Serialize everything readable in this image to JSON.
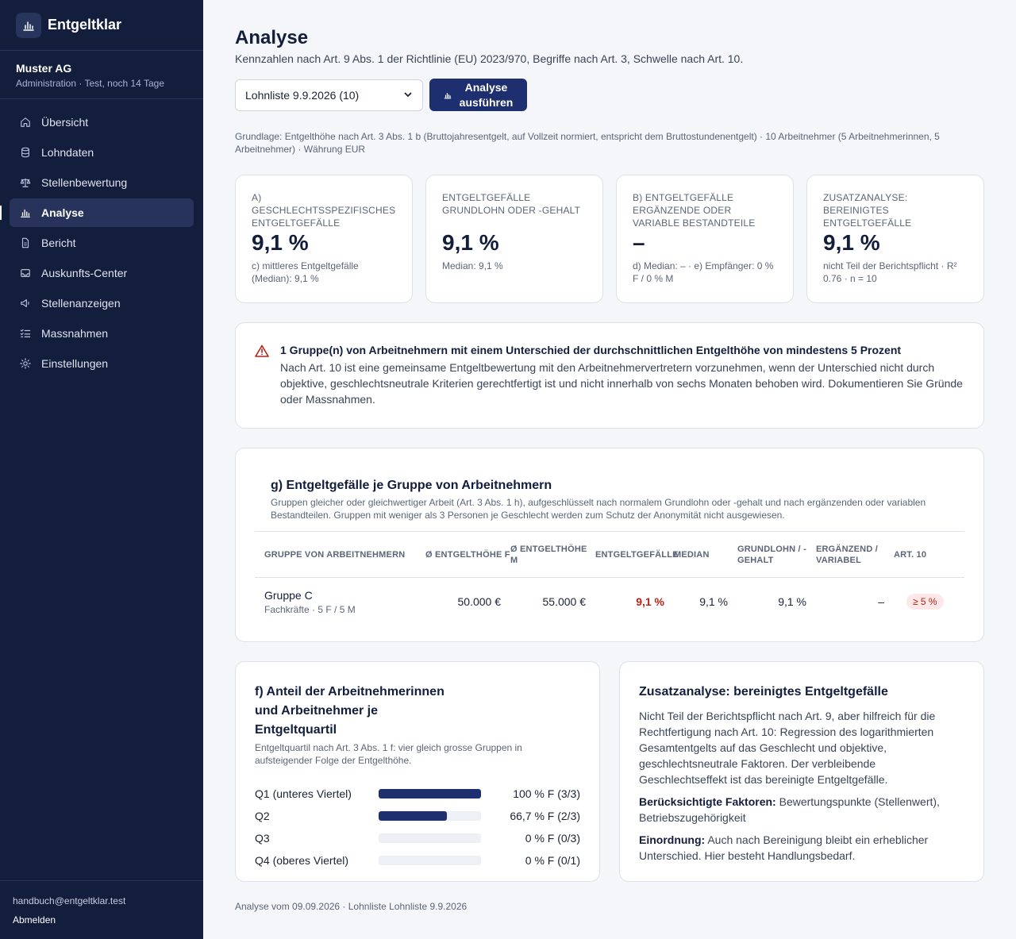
{
  "app": {
    "name": "Entgeltklar"
  },
  "org": {
    "name": "Muster AG",
    "meta": "Administration · Test, noch 14 Tage"
  },
  "nav": [
    {
      "label": "Übersicht",
      "icon": "home-icon"
    },
    {
      "label": "Lohndaten",
      "icon": "database-icon"
    },
    {
      "label": "Stellenbewertung",
      "icon": "scale-icon"
    },
    {
      "label": "Analyse",
      "icon": "bar-chart-icon",
      "active": true
    },
    {
      "label": "Bericht",
      "icon": "document-icon"
    },
    {
      "label": "Auskunfts-Center",
      "icon": "inbox-icon"
    },
    {
      "label": "Stellenanzeigen",
      "icon": "megaphone-icon"
    },
    {
      "label": "Massnahmen",
      "icon": "checklist-icon"
    },
    {
      "label": "Einstellungen",
      "icon": "settings-icon"
    }
  ],
  "user": {
    "email": "handbuch@entgeltklar.test",
    "logout": "Abmelden"
  },
  "page": {
    "title": "Analyse",
    "subtitle": "Kennzahlen nach Art. 9 Abs. 1 der Richtlinie (EU) 2023/970, Begriffe nach Art. 3, Schwelle nach Art. 10."
  },
  "controls": {
    "select_value": "Lohnliste 9.9.2026 (10)",
    "run_button_line1": "Analyse",
    "run_button_line2": "ausführen"
  },
  "basis": "Grundlage: Entgelthöhe nach Art. 3 Abs. 1 b (Bruttojahresentgelt, auf Vollzeit normiert, entspricht dem Bruttostundenentgelt) · 10 Arbeitnehmer (5 Arbeitnehmerinnen, 5 Arbeitnehmer) · Währung EUR",
  "kpis": [
    {
      "label": "a) geschlechtsspezifisches Entgeltgefälle",
      "value": "9,1 %",
      "note": "c) mittleres Entgeltgefälle (Median): 9,1 %"
    },
    {
      "label": "Entgeltgefälle Grundlohn oder -gehalt",
      "value": "9,1 %",
      "note": "Median: 9,1 %"
    },
    {
      "label": "b) Entgeltgefälle ergänzende oder variable Bestandteile",
      "value": "–",
      "note": "d) Median: – · e) Empfänger: 0 % F / 0 % M"
    },
    {
      "label": "Zusatzanalyse: bereinigtes Entgeltgefälle",
      "value": "9,1 %",
      "note": "nicht Teil der Berichtspflicht · R² 0.76 · n = 10"
    }
  ],
  "alert": {
    "title": "1 Gruppe(n) von Arbeitnehmern mit einem Unterschied der durchschnittlichen Entgelthöhe von mindestens 5 Prozent",
    "text": "Nach Art. 10 ist eine gemeinsame Entgeltbewertung mit den Arbeitnehmervertretern vorzunehmen, wenn der Unterschied nicht durch objektive, geschlechtsneutrale Kriterien gerechtfertigt ist und nicht innerhalb von sechs Monaten behoben wird. Dokumentieren Sie Gründe oder Massnahmen."
  },
  "groups": {
    "title": "g) Entgeltgefälle je Gruppe von Arbeitnehmern",
    "subtitle": "Gruppen gleicher oder gleichwertiger Arbeit (Art. 3 Abs. 1 h), aufgeschlüsselt nach normalem Grundlohn oder -gehalt und nach ergänzenden oder variablen Bestandteilen. Gruppen mit weniger als 3 Personen je Geschlecht werden zum Schutz der Anonymität nicht ausgewiesen.",
    "headers": [
      "Gruppe von Arbeitnehmern",
      "Ø Entgelthöhe F",
      "Ø Entgelthöhe M",
      "Entgeltgefälle",
      "Median",
      "Grundlohn / -gehalt",
      "Ergänzend / variabel",
      "Art. 10"
    ],
    "rows": [
      {
        "name": "Gruppe C",
        "meta": "Fachkräfte · 5 F / 5 M",
        "avg_f": "50.000 €",
        "avg_m": "55.000 €",
        "gap": "9,1 %",
        "median": "9,1 %",
        "base": "9,1 %",
        "variable": "–",
        "art10": "≥ 5 %"
      }
    ]
  },
  "quartiles": {
    "title_line1": "f) Anteil der Arbeitnehmerinnen",
    "title_line2": "und Arbeitnehmer je Entgeltquartil",
    "subtitle": "Entgeltquartil nach Art. 3 Abs. 1 f: vier gleich grosse Gruppen in aufsteigender Folge der Entgelthöhe.",
    "rows": [
      {
        "label": "Q1 (unteres Viertel)",
        "share": 1.0,
        "value": "100 % F (3/3)"
      },
      {
        "label": "Q2",
        "share": 0.667,
        "value": "66,7 % F (2/3)"
      },
      {
        "label": "Q3",
        "share": 0,
        "value": "0 % F (0/3)"
      },
      {
        "label": "Q4 (oberes Viertel)",
        "share": 0,
        "value": "0 % F (0/1)"
      }
    ]
  },
  "adjusted": {
    "title": "Zusatzanalyse: bereinigtes Entgeltgefälle",
    "p1": "Nicht Teil der Berichtspflicht nach Art. 9, aber hilfreich für die Rechtfertigung nach Art. 10: Regression des logarithmierten Gesamtentgelts auf das Geschlecht und objektive, geschlechtsneutrale Faktoren. Der verbleibende Geschlechtseffekt ist das bereinigte Entgeltgefälle.",
    "factors_label": "Berücksichtigte Faktoren:",
    "factors_text": " Bewertungspunkte (Stellenwert), Betriebszugehörigkeit",
    "class_label": "Einordnung:",
    "class_text": " Auch nach Bereinigung bleibt ein erheblicher Unterschied. Hier besteht Handlungsbedarf."
  },
  "footer": "Analyse vom 09.09.2026 · Lohnliste Lohnliste 9.9.2026",
  "colors": {
    "sidebar": "#131e3d",
    "primary": "#1d2f6e",
    "danger": "#b42318"
  }
}
